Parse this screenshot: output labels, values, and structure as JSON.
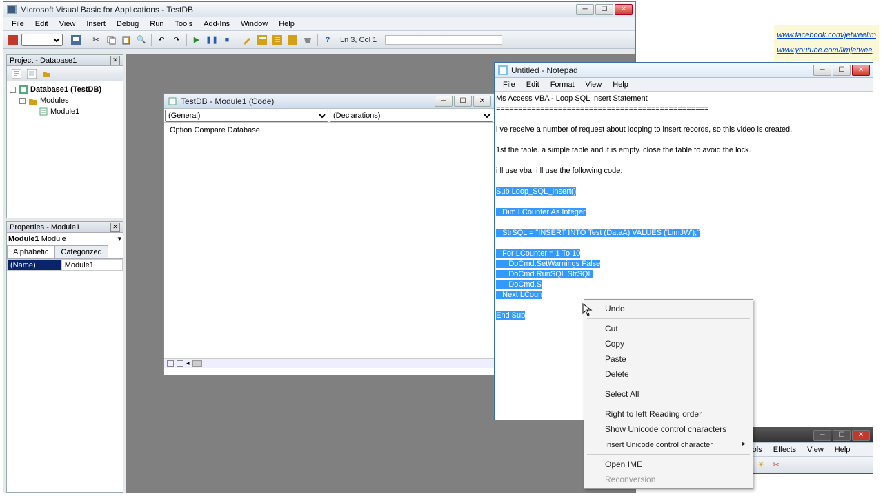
{
  "vba": {
    "title": "Microsoft Visual Basic for Applications - TestDB",
    "menu": [
      "File",
      "Edit",
      "View",
      "Insert",
      "Debug",
      "Run",
      "Tools",
      "Add-Ins",
      "Window",
      "Help"
    ],
    "status": "Ln 3, Col 1",
    "project": {
      "title": "Project - Database1",
      "root": "Database1 (TestDB)",
      "folder": "Modules",
      "module": "Module1"
    },
    "props": {
      "title": "Properties - Module1",
      "object": "Module1",
      "objtype": "Module",
      "tabs": [
        "Alphabetic",
        "Categorized"
      ],
      "name_key": "(Name)",
      "name_val": "Module1"
    },
    "codewin": {
      "title": "TestDB - Module1 (Code)",
      "dd1": "(General)",
      "dd2": "(Declarations)",
      "code": "Option Compare Database"
    }
  },
  "notepad": {
    "title": "Untitled - Notepad",
    "menu": [
      "File",
      "Edit",
      "Format",
      "View",
      "Help"
    ],
    "line1": "Ms Access VBA - Loop SQL Insert Statement",
    "line2": "================================================",
    "para1": "i ve receive a number of request about looping to insert records, so this video is created.",
    "para2": "1st the table. a simple table and it is empty. close the table to avoid the lock.",
    "para3": "i ll use vba. i ll use the following code:",
    "code": {
      "l1": "Sub Loop_SQL_Insert()",
      "l2": "   Dim LCounter As Integer",
      "l3": "   StrSQL = \"INSERT INTO Test (DataA) VALUES ('LimJW');\"",
      "l4": "   For LCounter = 1 To 10",
      "l5": "      DoCmd.SetWarnings False",
      "l6": "      DoCmd.RunSQL StrSQL",
      "l7": "      DoCmd.S",
      "l8": "   Next LCoun",
      "l9": "End Sub"
    }
  },
  "ctx": {
    "undo": "Undo",
    "cut": "Cut",
    "copy": "Copy",
    "paste": "Paste",
    "delete": "Delete",
    "selectall": "Select All",
    "rtl": "Right to left Reading order",
    "unicode": "Show Unicode control characters",
    "insertuni": "Insert Unicode control character",
    "ime": "Open IME",
    "reconv": "Reconversion"
  },
  "social": {
    "fb": "www.facebook.com/jetweelim",
    "yt": "www.youtube.com/limjetwee"
  },
  "other": {
    "menu": [
      "Tools",
      "Effects",
      "View",
      "Help"
    ]
  }
}
